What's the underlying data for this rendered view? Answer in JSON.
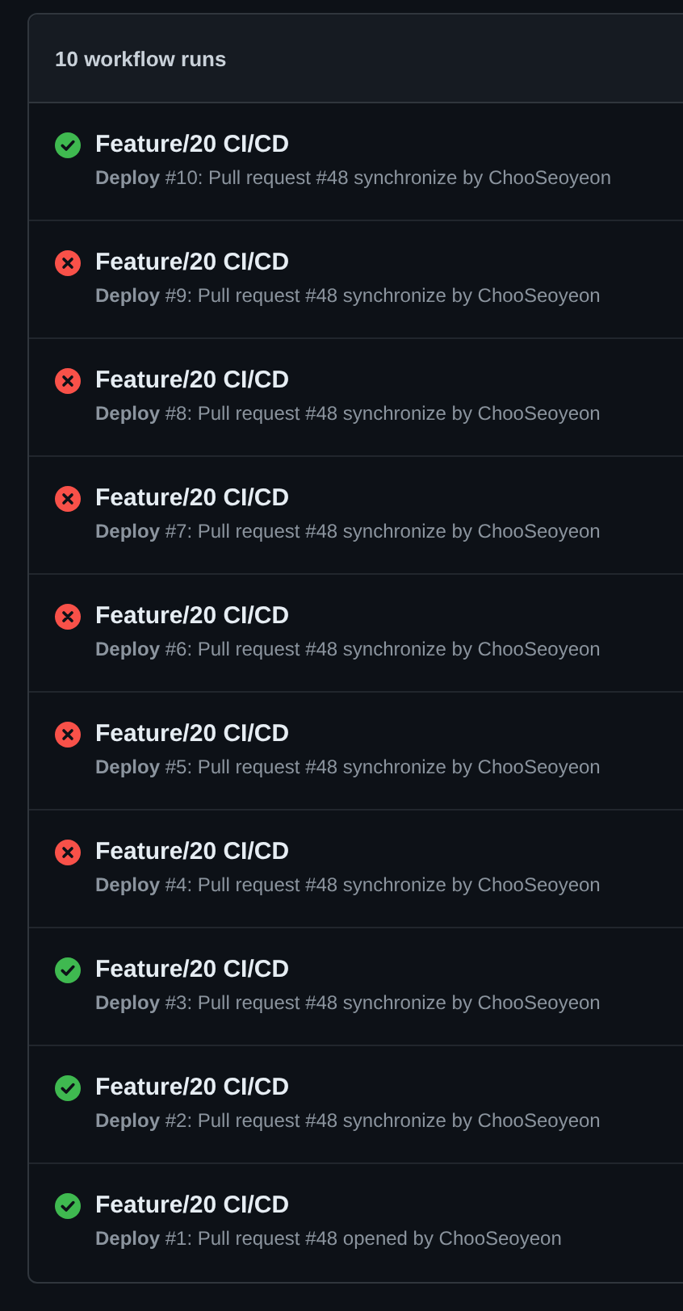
{
  "header": {
    "title": "10 workflow runs"
  },
  "runs": [
    {
      "kind": "success",
      "title": "Feature/20 CI/CD",
      "detail": "**Deploy** #10: Pull request #48 synchronize by ChooSeoyeon"
    },
    {
      "kind": "failure",
      "title": "Feature/20 CI/CD",
      "detail": "**Deploy** #9: Pull request #48 synchronize by ChooSeoyeon"
    },
    {
      "kind": "failure",
      "title": "Feature/20 CI/CD",
      "detail": "**Deploy** #8: Pull request #48 synchronize by ChooSeoyeon"
    },
    {
      "kind": "failure",
      "title": "Feature/20 CI/CD",
      "detail": "**Deploy** #7: Pull request #48 synchronize by ChooSeoyeon"
    },
    {
      "kind": "failure",
      "title": "Feature/20 CI/CD",
      "detail": "**Deploy** #6: Pull request #48 synchronize by ChooSeoyeon"
    },
    {
      "kind": "failure",
      "title": "Feature/20 CI/CD",
      "detail": "**Deploy** #5: Pull request #48 synchronize by ChooSeoyeon"
    },
    {
      "kind": "failure",
      "title": "Feature/20 CI/CD",
      "detail": "**Deploy** #4: Pull request #48 synchronize by ChooSeoyeon"
    },
    {
      "kind": "success",
      "title": "Feature/20 CI/CD",
      "detail": "**Deploy** #3: Pull request #48 synchronize by ChooSeoyeon"
    },
    {
      "kind": "success",
      "title": "Feature/20 CI/CD",
      "detail": "**Deploy** #2: Pull request #48 synchronize by ChooSeoyeon"
    },
    {
      "kind": "success",
      "title": "Feature/20 CI/CD",
      "detail": "**Deploy** #1: Pull request #48 opened by ChooSeoyeon"
    }
  ]
}
